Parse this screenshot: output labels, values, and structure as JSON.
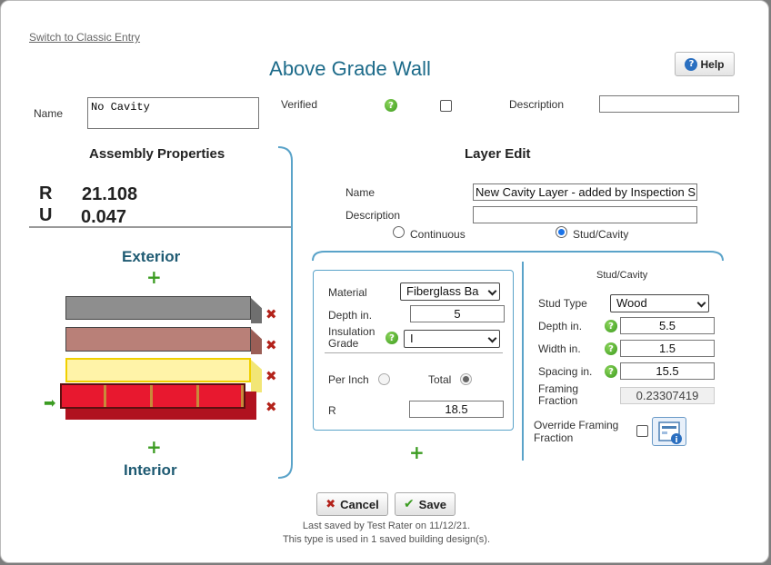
{
  "switch_link": "Switch to Classic Entry",
  "title": "Above Grade Wall",
  "help_label": "Help",
  "name_label": "Name",
  "name_value": "No Cavity",
  "verified_label": "Verified",
  "description_label": "Description",
  "assembly": {
    "heading": "Assembly Properties",
    "r_label": "R",
    "r_value": "21.108",
    "u_label": "U",
    "u_value": "0.047",
    "exterior_label": "Exterior",
    "interior_label": "Interior",
    "layers": [
      {
        "color": "#8e8e8e",
        "side": "#6f6f6f"
      },
      {
        "color": "#b98078",
        "side": "#9b5e56"
      },
      {
        "color": "#fff3a8",
        "side": "#f2e676"
      },
      {
        "color": "#e8182f",
        "side": "#b0121f"
      }
    ]
  },
  "layer_edit": {
    "heading": "Layer Edit",
    "name_label": "Name",
    "name_value": "New Cavity Layer - added by Inspection S",
    "description_label": "Description",
    "continuous_label": "Continuous",
    "stud_cavity_label": "Stud/Cavity",
    "material_label": "Material",
    "material_value": "Fiberglass Ba",
    "depth_label": "Depth in.",
    "depth_value": "5",
    "insulation_grade_label": "Insulation Grade",
    "insulation_grade_value": "I",
    "per_inch_label": "Per Inch",
    "total_label": "Total",
    "r_label": "R",
    "r_value": "18.5"
  },
  "stud": {
    "heading": "Stud/Cavity",
    "stud_type_label": "Stud Type",
    "stud_type_value": "Wood",
    "depth_label": "Depth in.",
    "depth_value": "5.5",
    "width_label": "Width in.",
    "width_value": "1.5",
    "spacing_label": "Spacing in.",
    "spacing_value": "15.5",
    "framing_fraction_label": "Framing Fraction",
    "framing_fraction_value": "0.23307419",
    "override_label": "Override Framing Fraction"
  },
  "cancel_label": "Cancel",
  "save_label": "Save",
  "last_saved": "Last saved by Test Rater on 11/12/21.",
  "used_in": "This type is used in 1 saved building design(s)."
}
